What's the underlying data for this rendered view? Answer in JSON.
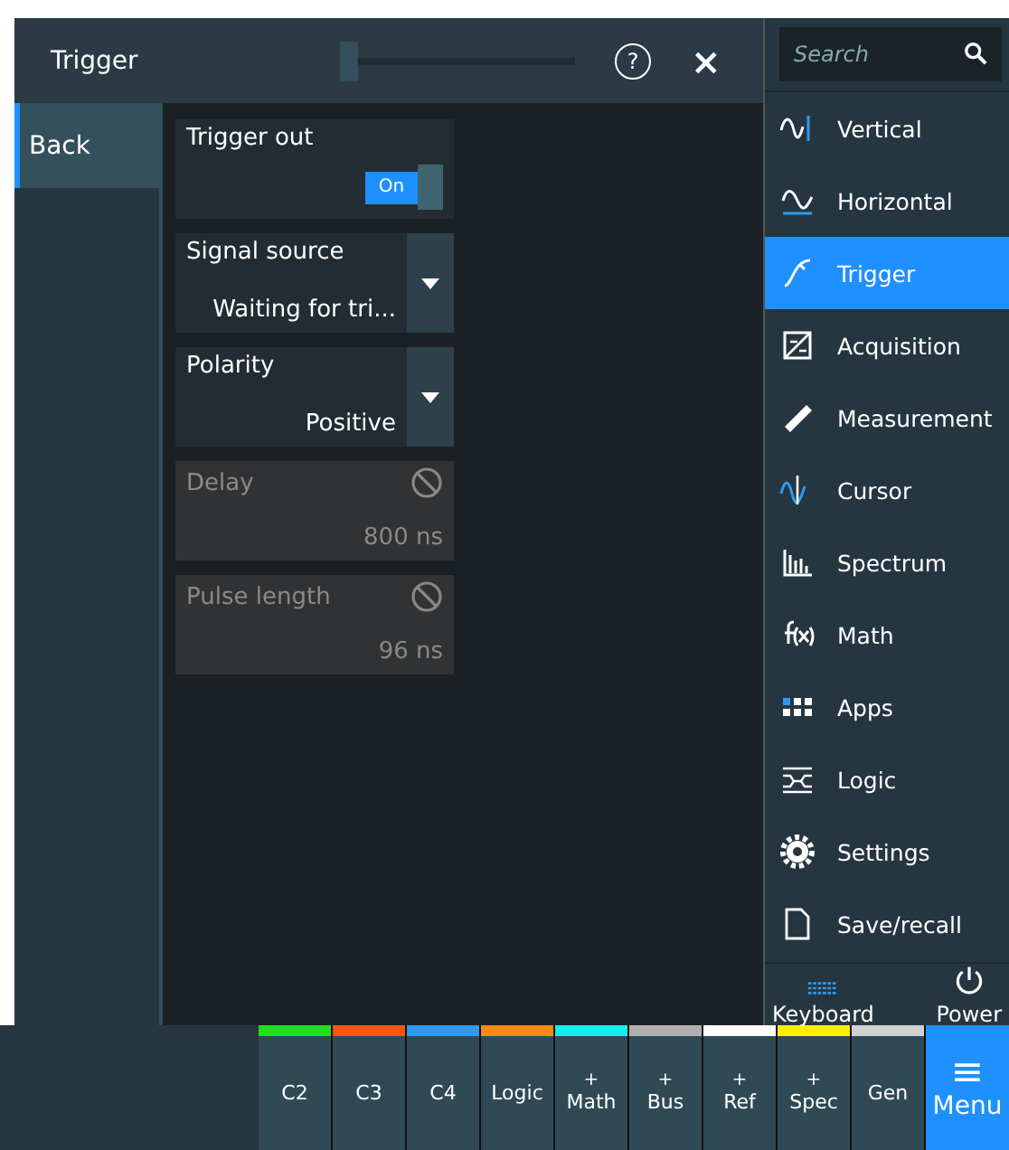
{
  "header": {
    "title": "Trigger",
    "slider": {
      "level": 0.0
    },
    "help": "?",
    "close": "×"
  },
  "sidebar": {
    "items": [
      {
        "label": "Back",
        "selected": true
      }
    ]
  },
  "settings": [
    {
      "kind": "toggle",
      "label": "Trigger out",
      "value": "On",
      "on": true,
      "disabled": false
    },
    {
      "kind": "dropdown",
      "label": "Signal source",
      "value": "Waiting for tri...",
      "disabled": false
    },
    {
      "kind": "dropdown",
      "label": "Polarity",
      "value": "Positive",
      "disabled": false
    },
    {
      "kind": "number",
      "label": "Delay",
      "value": "800 ns",
      "disabled": true
    },
    {
      "kind": "number",
      "label": "Pulse length",
      "value": "96 ns",
      "disabled": true
    }
  ],
  "menu": {
    "search": {
      "placeholder": "Search"
    },
    "items": [
      {
        "label": "Vertical",
        "selected": false
      },
      {
        "label": "Horizontal",
        "selected": false
      },
      {
        "label": "Trigger",
        "selected": true
      },
      {
        "label": "Acquisition",
        "selected": false
      },
      {
        "label": "Measurement",
        "selected": false
      },
      {
        "label": "Cursor",
        "selected": false
      },
      {
        "label": "Spectrum",
        "selected": false
      },
      {
        "label": "Math",
        "selected": false
      },
      {
        "label": "Apps",
        "selected": false
      },
      {
        "label": "Logic",
        "selected": false
      },
      {
        "label": "Settings",
        "selected": false
      },
      {
        "label": "Save/recall",
        "selected": false
      }
    ],
    "footer": [
      {
        "label": "Keyboard"
      },
      {
        "label": "Power"
      }
    ]
  },
  "channels": [
    {
      "label": "C2",
      "color": "#22dd22"
    },
    {
      "label": "C3",
      "color": "#ff5511"
    },
    {
      "label": "C4",
      "color": "#3399ee"
    },
    {
      "label": "Logic",
      "color": "#ff8811"
    },
    {
      "prefix": "+",
      "label": "Math",
      "color": "#11eeee"
    },
    {
      "prefix": "+",
      "label": "Bus",
      "color": "#b0b0b0"
    },
    {
      "prefix": "+",
      "label": "Ref",
      "color": "#ffffff"
    },
    {
      "prefix": "+",
      "label": "Spec",
      "color": "#ffee00"
    },
    {
      "label": "Gen",
      "color": "#d0d0d0"
    }
  ],
  "menu_button": {
    "icon": "≡",
    "label": "Menu"
  }
}
